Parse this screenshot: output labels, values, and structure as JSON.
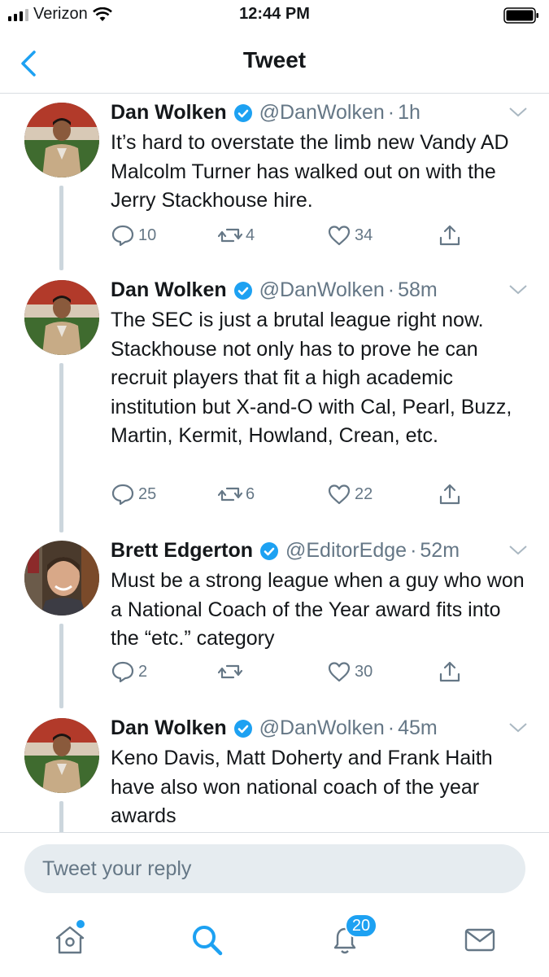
{
  "status_bar": {
    "carrier": "Verizon",
    "time": "12:44 PM"
  },
  "header": {
    "title": "Tweet"
  },
  "tweets": [
    {
      "name": "Dan Wolken",
      "handle": "@DanWolken",
      "ago": "1h",
      "text": "It’s hard to overstate the limb new Vandy AD Malcolm Turner has walked out on with the Jerry Stackhouse hire.",
      "replies": "10",
      "retweets": "4",
      "likes": "34"
    },
    {
      "name": "Dan Wolken",
      "handle": "@DanWolken",
      "ago": "58m",
      "text": "The SEC is just a brutal league right now. Stackhouse not only has to prove he can recruit players that fit a high academic institution but X-and-O with Cal, Pearl, Buzz, Martin, Kermit, Howland, Crean, etc.",
      "replies": "25",
      "retweets": "6",
      "likes": "22"
    },
    {
      "name": "Brett Edgerton",
      "handle": "@EditorEdge",
      "ago": "52m",
      "text": "Must be a strong league when a guy who won a National Coach of the Year award fits into the “etc.” category",
      "replies": "2",
      "retweets": "",
      "likes": "30"
    },
    {
      "name": "Dan Wolken",
      "handle": "@DanWolken",
      "ago": "45m",
      "text": "Keno Davis, Matt Doherty and Frank Haith have also won national coach of the year awards"
    }
  ],
  "reply": {
    "placeholder": "Tweet your reply"
  },
  "tabbar": {
    "notifications_badge": "20"
  },
  "icons": {
    "back": "chevron-left-icon",
    "verified": "verified-badge-icon",
    "caret": "chevron-down-icon",
    "reply": "reply-icon",
    "retweet": "retweet-icon",
    "like": "heart-icon",
    "share": "share-icon",
    "home": "home-icon",
    "search": "search-icon",
    "notifications": "bell-icon",
    "messages": "mail-icon"
  },
  "colors": {
    "accent": "#1da1f2",
    "secondary_text": "#657786",
    "thread_line": "#ccd6dd"
  }
}
